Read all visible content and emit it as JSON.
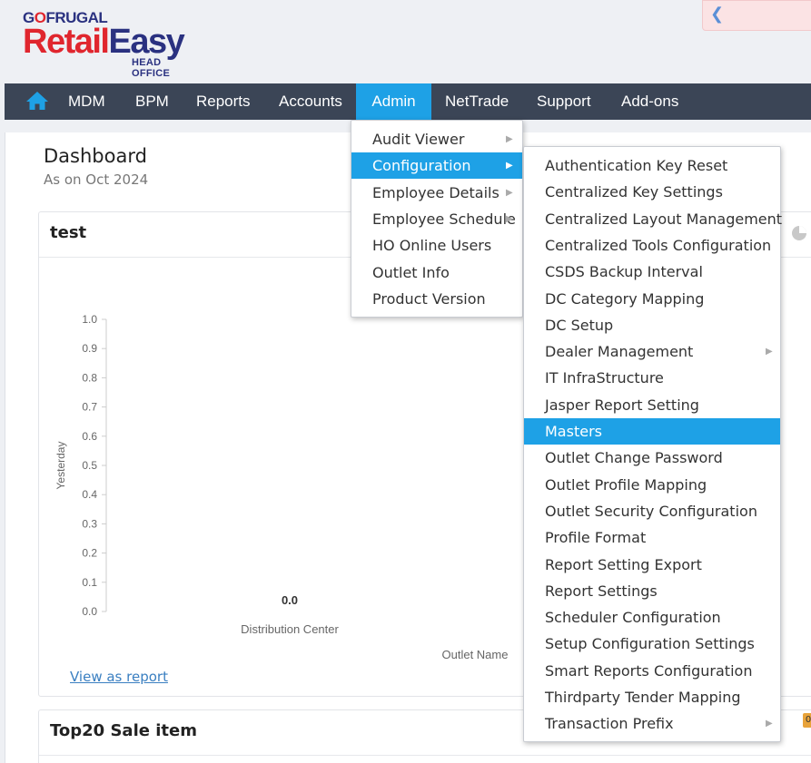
{
  "brand": {
    "top_prefix": "G",
    "top_o": "O",
    "top_rest": "FRUGAL",
    "main_part1": "Retail",
    "main_part2": "Easy",
    "sub": "HEAD OFFICE"
  },
  "nav": {
    "items": [
      "MDM",
      "BPM",
      "Reports",
      "Accounts",
      "Admin",
      "NetTrade",
      "Support",
      "Add-ons"
    ],
    "active": "Admin"
  },
  "dashboard": {
    "title": "Dashboard",
    "subtitle": "As on Oct 2024"
  },
  "card1": {
    "title": "test",
    "view_link": "View as report"
  },
  "card2": {
    "title": "Top20 Sale item"
  },
  "admin_menu": {
    "items": [
      "Audit Viewer",
      "Configuration",
      "Employee Details",
      "Employee Schedule",
      "HO Online Users",
      "Outlet Info",
      "Product Version"
    ],
    "has_submenu": [
      true,
      true,
      true,
      true,
      false,
      false,
      false
    ],
    "active_index": 1
  },
  "config_menu": {
    "items": [
      "Authentication Key Reset",
      "Centralized Key Settings",
      "Centralized Layout Management",
      "Centralized Tools Configuration",
      "CSDS Backup Interval",
      "DC Category Mapping",
      "DC Setup",
      "Dealer Management",
      "IT InfraStructure",
      "Jasper Report Setting",
      "Masters",
      "Outlet Change Password",
      "Outlet Profile Mapping",
      "Outlet Security Configuration",
      "Profile Format",
      "Report Setting Export",
      "Report Settings",
      "Scheduler Configuration",
      "Setup Configuration Settings",
      "Smart Reports Configuration",
      "Thirdparty Tender Mapping",
      "Transaction Prefix"
    ],
    "has_submenu_indices": [
      7,
      21
    ],
    "active_index": 10
  },
  "chart_data": {
    "type": "bar",
    "categories": [
      "Distribution Center"
    ],
    "values": [
      0.0
    ],
    "value_labels": [
      "0.0"
    ],
    "title": "",
    "xlabel": "Outlet Name",
    "ylabel": "Yesterday",
    "ylim": [
      0,
      1.0
    ],
    "yticks": [
      "0.0",
      "0.1",
      "0.2",
      "0.3",
      "0.4",
      "0.5",
      "0.6",
      "0.7",
      "0.8",
      "0.9",
      "1.0"
    ]
  },
  "badge": "0",
  "colors": {
    "nav_bg": "#3b4556",
    "accent": "#1ea1e6",
    "brand_red": "#e0262e",
    "brand_blue": "#2a3180"
  }
}
